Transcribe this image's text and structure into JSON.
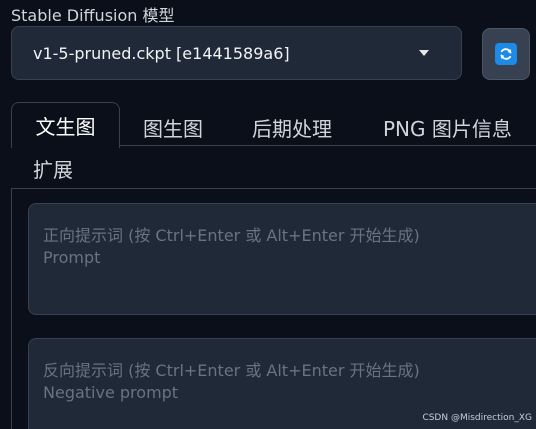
{
  "model": {
    "label": "Stable Diffusion 模型",
    "selected": "v1-5-pruned.ckpt [e1441589a6]"
  },
  "tabs": [
    {
      "label": "文生图",
      "active": true
    },
    {
      "label": "图生图"
    },
    {
      "label": "后期处理"
    },
    {
      "label": "PNG 图片信息"
    },
    {
      "label": "扩展"
    }
  ],
  "prompt": {
    "hint": "正向提示词 (按 Ctrl+Enter 或 Alt+Enter 开始生成)",
    "placeholder": "Prompt"
  },
  "negative_prompt": {
    "hint": "反向提示词 (按 Ctrl+Enter 或 Alt+Enter 开始生成)",
    "placeholder": "Negative prompt"
  },
  "watermark": "CSDN @Misdirection_XG",
  "icons": {
    "refresh": "refresh-icon",
    "dropdown": "chevron-down-icon"
  },
  "colors": {
    "background": "#0b0f19",
    "panel": "#1f2937",
    "border": "#374151",
    "refresh_accent": "#1d8ae6"
  }
}
